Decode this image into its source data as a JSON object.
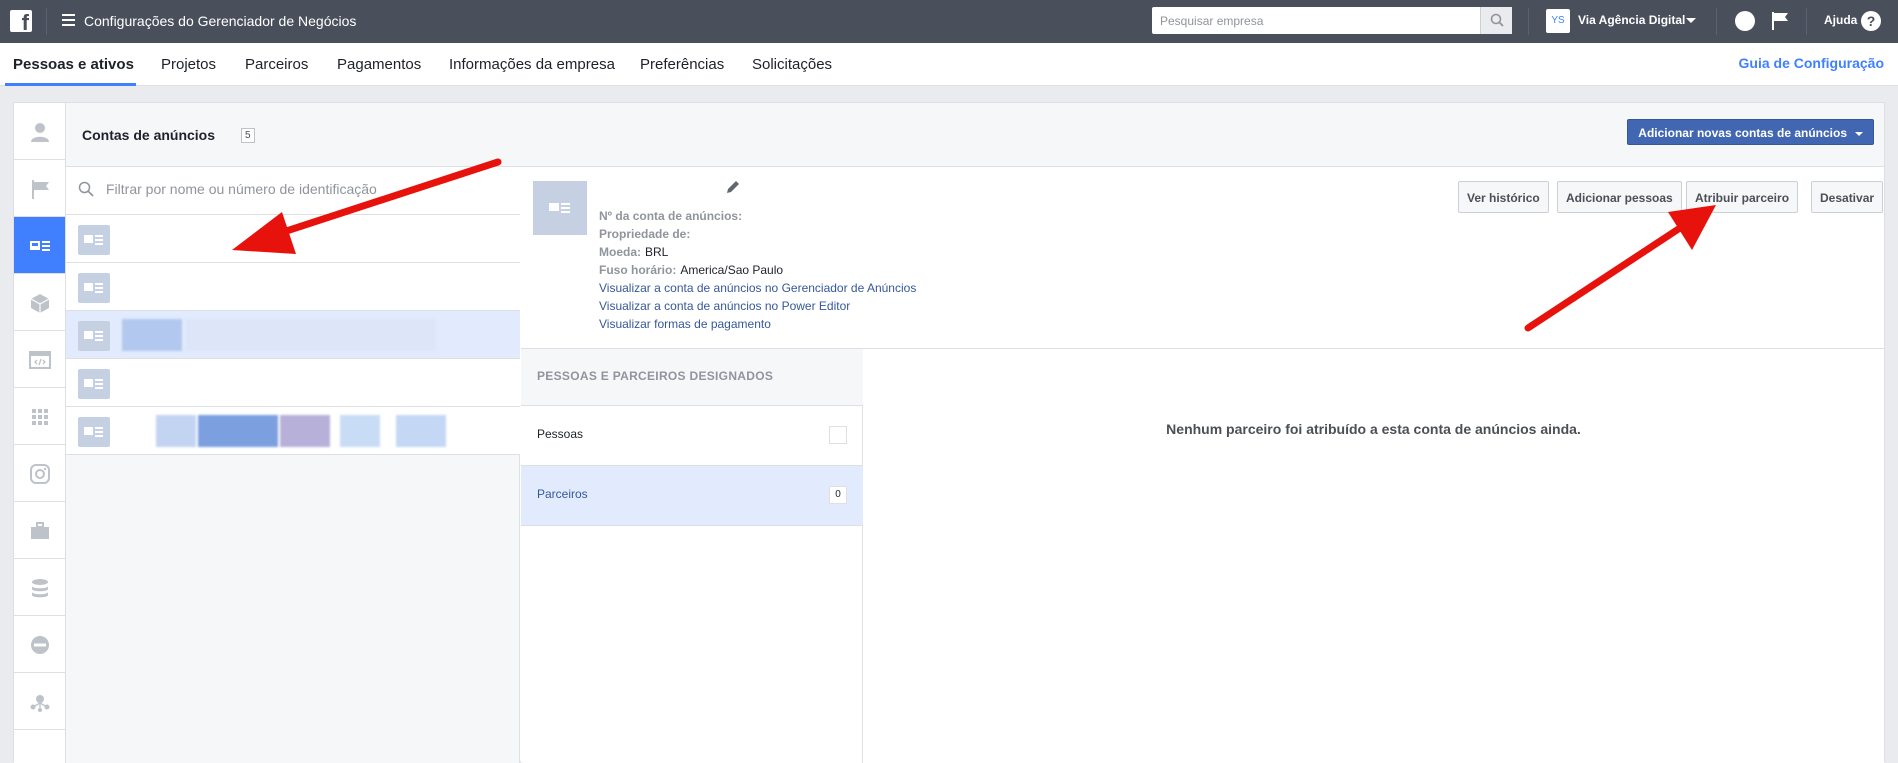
{
  "topbar": {
    "logo": "f",
    "title": "Configurações do Gerenciador de Negócios",
    "search_placeholder": "Pesquisar empresa",
    "business_avatar": "YS",
    "business_name": "Via Agência Digital",
    "help_label": "Ajuda",
    "help_icon_glyph": "?"
  },
  "tabs": [
    {
      "label": "Pessoas e ativos",
      "active": true
    },
    {
      "label": "Projetos"
    },
    {
      "label": "Parceiros"
    },
    {
      "label": "Pagamentos"
    },
    {
      "label": "Informações da empresa"
    },
    {
      "label": "Preferências"
    },
    {
      "label": "Solicitações"
    }
  ],
  "guide_link": "Guia de Configuração",
  "rail_icons": [
    "person-icon",
    "flag-icon",
    "ad-account-icon",
    "cube-icon",
    "code-window-icon",
    "grid-icon",
    "instagram-icon",
    "briefcase-icon",
    "database-icon",
    "block-icon",
    "network-icon"
  ],
  "panel": {
    "title": "Contas de anúncios",
    "count": "5",
    "add_button": "Adicionar novas contas de anúncios",
    "filter_placeholder": "Filtrar por nome ou número de identificação"
  },
  "detail": {
    "fields": [
      {
        "key": "Nº da conta de anúncios:",
        "value": ""
      },
      {
        "key": "Propriedade de:",
        "value": ""
      },
      {
        "key": "Moeda:",
        "value": "BRL"
      },
      {
        "key": "Fuso horário:",
        "value": "America/Sao Paulo"
      }
    ],
    "links": [
      "Visualizar a conta de anúncios no Gerenciador de Anúncios",
      "Visualizar a conta de anúncios no Power Editor",
      "Visualizar formas de pagamento"
    ],
    "buttons": {
      "history": "Ver histórico",
      "add_people": "Adicionar pessoas",
      "assign_partner": "Atribuir parceiro",
      "deactivate": "Desativar"
    },
    "assigned_header": "PESSOAS E PARCEIROS DESIGNADOS",
    "assigned_items": [
      {
        "label": "Pessoas",
        "count": ""
      },
      {
        "label": "Parceiros",
        "count": "0"
      }
    ],
    "empty_message": "Nenhum parceiro foi atribuído a esta conta de anúncios ainda."
  },
  "colors": {
    "topbar": "#4a4f5c",
    "accent": "#4080ff",
    "primary_button": "#4267b2",
    "annotation_arrow": "#e8120c"
  }
}
